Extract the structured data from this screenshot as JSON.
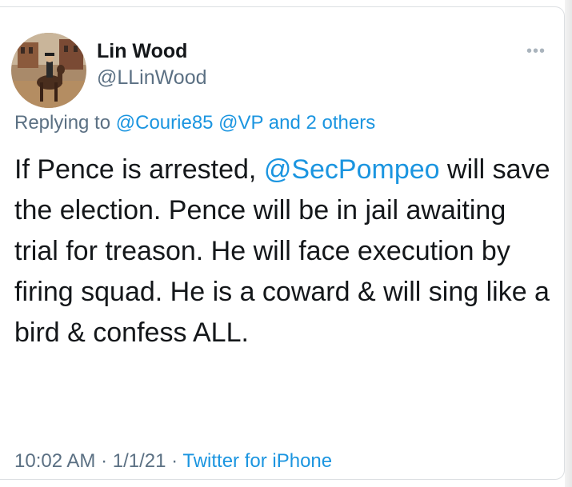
{
  "tweet": {
    "author_name": "Lin Wood",
    "author_handle": "@LLinWood",
    "more_icon": "•••",
    "reply": {
      "prefix": "Replying to ",
      "targets": "@Courie85 @VP and 2 others"
    },
    "text": {
      "part1": "If Pence is arrested, ",
      "mention": "@SecPompeo",
      "part2": " will save the election. Pence will be in jail awaiting trial for treason. He will face execution by firing squad. He is a coward & will sing like a bird & confess ALL."
    },
    "meta": {
      "time": "10:02 AM",
      "sep1": " · ",
      "date": "1/1/21",
      "sep2": " · ",
      "source": "Twitter for iPhone"
    }
  },
  "colors": {
    "link": "#1b95e0",
    "muted": "#5b7083",
    "text": "#14171a"
  }
}
